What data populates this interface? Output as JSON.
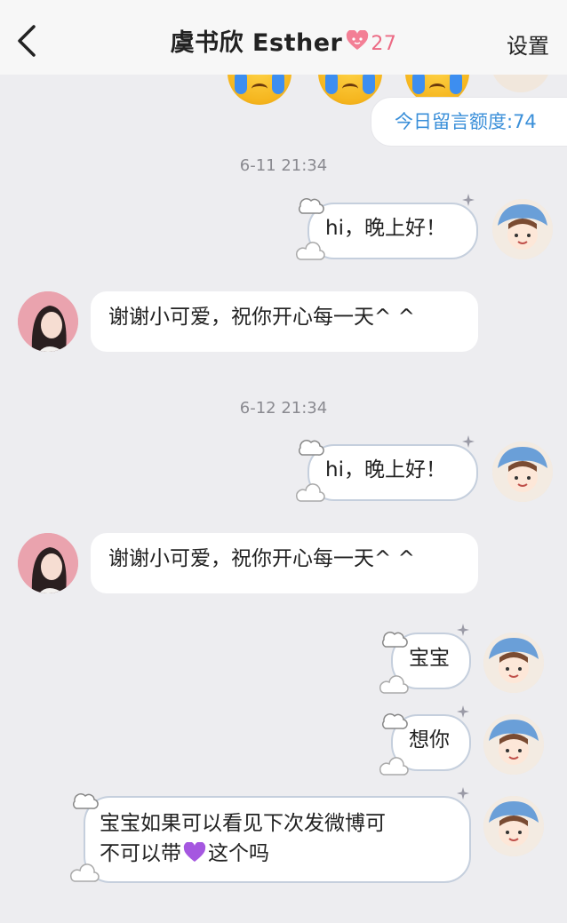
{
  "header": {
    "back_icon": "chevron-left-icon",
    "title": "虞书欣 Esther",
    "badge_icon": "heart-badge-icon",
    "badge_count": "27",
    "settings_label": "设置"
  },
  "quota_label": "今日留言额度:74",
  "colors": {
    "background": "#ededf0",
    "accent": "#3a8fd9",
    "badge": "#ec6a84",
    "bubble_border": "#c5cfdd"
  },
  "messages": [
    {
      "type": "timestamp",
      "text": "6-11 21:34"
    },
    {
      "type": "outgoing",
      "text": "hi，晚上好！"
    },
    {
      "type": "incoming",
      "text": "谢谢小可爱，祝你开心每一天^ ^"
    },
    {
      "type": "timestamp",
      "text": "6-12 21:34"
    },
    {
      "type": "outgoing",
      "text": "hi，晚上好！"
    },
    {
      "type": "incoming",
      "text": "谢谢小可爱，祝你开心每一天^ ^"
    },
    {
      "type": "outgoing",
      "text": "宝宝"
    },
    {
      "type": "outgoing",
      "text": "想你"
    },
    {
      "type": "outgoing",
      "line1": "宝宝如果可以看见下次发微博可",
      "line2_before": "不可以带",
      "emoji": "purple-heart-icon",
      "line2_after": "这个吗"
    }
  ]
}
